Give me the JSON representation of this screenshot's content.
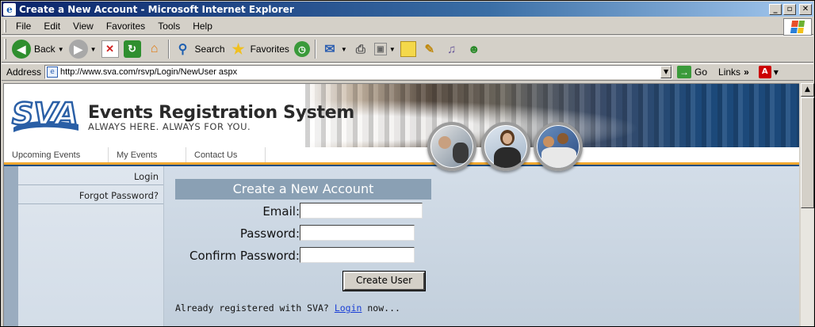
{
  "window": {
    "title": "Create a New Account - Microsoft Internet Explorer",
    "minimize": "_",
    "maximize": "▫",
    "close": "✕"
  },
  "menu": {
    "items": [
      {
        "label": "File",
        "key": "F"
      },
      {
        "label": "Edit",
        "key": "E"
      },
      {
        "label": "View",
        "key": "V"
      },
      {
        "label": "Favorites",
        "key": "a"
      },
      {
        "label": "Tools",
        "key": "T"
      },
      {
        "label": "Help",
        "key": "H"
      }
    ]
  },
  "toolbar": {
    "back_label": "Back",
    "search_label": "Search",
    "favorites_label": "Favorites",
    "colors": {
      "back": "#2f8f2f",
      "stop": "#d02020",
      "refresh": "#2f8f2f",
      "home": "#e07a10"
    }
  },
  "address": {
    "label": "Address",
    "url": "http://www.sva.com/rsvp/Login/NewUser aspx",
    "go_label": "Go",
    "links_label": "Links",
    "links_chevron": "»"
  },
  "site": {
    "logo_text": "SVA",
    "title": "Events Registration System",
    "tagline": "ALWAYS HERE. ALWAYS FOR YOU.",
    "nav": [
      "Upcoming Events",
      "My Events",
      "Contact Us"
    ],
    "sidebar": [
      "Login",
      "Forgot Password?"
    ],
    "accent_color": "#f0a830"
  },
  "form": {
    "header": "Create a New Account",
    "email_label": "Email:",
    "password_label": "Password:",
    "confirm_label": "Confirm Password:",
    "email_value": "",
    "password_value": "",
    "confirm_value": "",
    "submit_label": "Create User",
    "already_prefix": "Already registered with SVA?",
    "already_link": "Login",
    "already_suffix": "now..."
  }
}
